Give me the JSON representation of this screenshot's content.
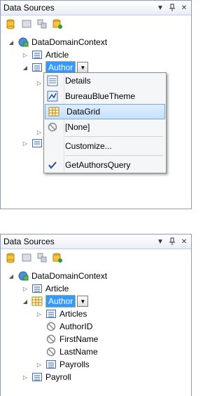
{
  "panel1": {
    "title": "Data Sources",
    "tree": {
      "root": "DataDomainContext",
      "article": "Article",
      "author": "Author"
    },
    "menu": {
      "items": [
        "Details",
        "BureauBlueTheme",
        "DataGrid",
        "[None]",
        "Customize...",
        "GetAuthorsQuery"
      ],
      "highlighted": "DataGrid",
      "checked": "GetAuthorsQuery"
    }
  },
  "panel2": {
    "title": "Data Sources",
    "tree": {
      "root": "DataDomainContext",
      "article": "Article",
      "author": "Author",
      "children": [
        "Articles",
        "AuthorID",
        "FirstName",
        "LastName",
        "Payrolls"
      ],
      "payroll": "Payroll"
    }
  },
  "colors": {
    "selection": "#3399ff",
    "menu_highlight": "#c5e0ff",
    "panel_border": "#8e9bbc"
  }
}
